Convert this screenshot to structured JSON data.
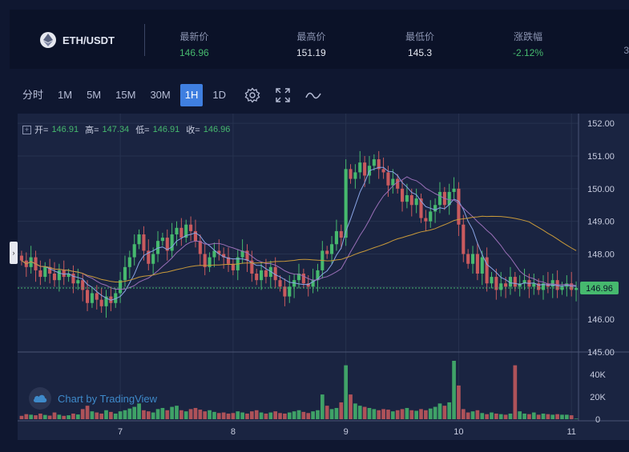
{
  "header": {
    "pair": "ETH/USDT",
    "coin_icon": "ethereum-icon",
    "stats": [
      {
        "label": "最新价",
        "value": "146.96",
        "color": "green"
      },
      {
        "label": "最高价",
        "value": "151.19",
        "color": "white"
      },
      {
        "label": "最低价",
        "value": "145.3",
        "color": "white"
      },
      {
        "label": "涨跌幅",
        "value": "-2.12%",
        "color": "green"
      }
    ],
    "edge_text": "3"
  },
  "toolbar": {
    "timeframes": [
      "分时",
      "1M",
      "5M",
      "15M",
      "30M",
      "1H",
      "1D"
    ],
    "active": "1H",
    "icons": [
      "settings-icon",
      "fullscreen-icon",
      "line-style-icon"
    ]
  },
  "legend": {
    "open_label": "开=",
    "open": "146.91",
    "high_label": "高=",
    "high": "147.34",
    "low_label": "低=",
    "low": "146.91",
    "close_label": "收=",
    "close": "146.96"
  },
  "watermark": "Chart by TradingView",
  "colors": {
    "up": "#46b96e",
    "down": "#c95a5e",
    "bg": "#1a2441",
    "ma1": "#8aa5e6",
    "ma2": "#9a6fb8",
    "ma3": "#c99a3a",
    "price_tag": "#46b96e"
  },
  "chart_data": {
    "type": "candlestick",
    "x_ticks": [
      "7",
      "8",
      "9",
      "10",
      "11"
    ],
    "x_tick_index": [
      21,
      45,
      69,
      93,
      117
    ],
    "y_ticks": [
      145.0,
      146.0,
      147.0,
      148.0,
      149.0,
      150.0,
      151.0,
      152.0
    ],
    "y_tick_labels": [
      "145.00",
      "146.00",
      "146.96",
      "148.00",
      "149.00",
      "150.00",
      "151.00",
      "152.00"
    ],
    "ylim": [
      145.0,
      152.2
    ],
    "last_price": 146.96,
    "last_price_label": "146.96",
    "volume_ticks": [
      0,
      20000,
      40000
    ],
    "volume_tick_labels": [
      "0",
      "20K",
      "40K"
    ],
    "volume_max": 52000,
    "close": [
      147.8,
      147.6,
      147.9,
      147.5,
      147.3,
      147.6,
      147.4,
      147.2,
      147.5,
      147.3,
      147.4,
      147.1,
      147.2,
      146.9,
      146.5,
      146.8,
      146.6,
      146.4,
      146.7,
      146.5,
      146.8,
      147.2,
      147.6,
      147.9,
      148.3,
      148.6,
      148.1,
      147.7,
      148.0,
      148.4,
      148.5,
      148.1,
      148.6,
      148.8,
      148.5,
      148.9,
      148.7,
      148.4,
      148.0,
      147.6,
      147.9,
      148.1,
      148.0,
      147.9,
      147.7,
      147.5,
      147.9,
      148.1,
      147.8,
      147.4,
      147.2,
      147.5,
      147.3,
      147.6,
      147.2,
      147.0,
      146.7,
      147.0,
      147.2,
      147.4,
      147.1,
      147.0,
      147.2,
      147.5,
      148.1,
      148.0,
      148.3,
      148.7,
      148.5,
      150.6,
      150.3,
      150.5,
      150.8,
      150.4,
      150.7,
      150.9,
      150.6,
      150.5,
      150.1,
      150.3,
      150.0,
      149.6,
      149.8,
      149.5,
      149.7,
      149.1,
      149.0,
      149.3,
      149.5,
      149.9,
      149.5,
      149.9,
      150.0,
      148.9,
      148.0,
      147.7,
      148.0,
      147.4,
      147.9,
      147.1,
      147.3,
      146.9,
      147.1,
      147.0,
      147.3,
      147.0,
      147.1,
      147.2,
      147.0,
      147.1,
      146.9,
      147.1,
      147.0,
      147.2,
      146.9,
      147.0,
      147.1,
      146.9,
      146.96
    ],
    "volume": [
      3000,
      4500,
      4000,
      3500,
      5000,
      3800,
      3200,
      6000,
      4000,
      3000,
      3500,
      5000,
      4200,
      9000,
      12000,
      7000,
      6000,
      5000,
      8000,
      6500,
      5000,
      7000,
      8000,
      9500,
      11000,
      14000,
      8000,
      7000,
      6000,
      9000,
      10000,
      8000,
      11000,
      12000,
      8000,
      7000,
      9000,
      10000,
      8500,
      7000,
      8000,
      6500,
      5500,
      6000,
      5000,
      5500,
      7000,
      6000,
      5000,
      7000,
      8000,
      6000,
      5000,
      6000,
      7000,
      5500,
      5000,
      6000,
      7000,
      8000,
      6500,
      5500,
      7000,
      8000,
      22000,
      12000,
      9000,
      10000,
      15000,
      48000,
      22000,
      14000,
      12000,
      11000,
      10000,
      9000,
      8000,
      9000,
      8500,
      7000,
      8000,
      9000,
      10000,
      8000,
      7500,
      9000,
      8000,
      9500,
      11000,
      14000,
      12000,
      15000,
      52000,
      30000,
      9000,
      6000,
      7000,
      8000,
      5500,
      4500,
      6000,
      5000,
      4500,
      4000,
      5000,
      48000,
      7000,
      5000,
      4500,
      6000,
      4000,
      5000,
      4500,
      4000,
      4500,
      4000,
      4000,
      3500,
      500
    ]
  }
}
